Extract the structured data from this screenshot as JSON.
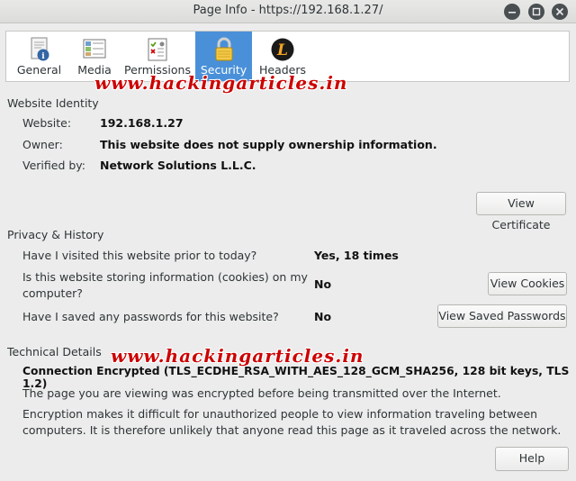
{
  "window": {
    "title": "Page Info - https://192.168.1.27/"
  },
  "tabs": [
    {
      "label": "General",
      "icon": "document-icon"
    },
    {
      "label": "Media",
      "icon": "media-icon"
    },
    {
      "label": "Permissions",
      "icon": "permissions-icon"
    },
    {
      "label": "Security",
      "icon": "lock-icon"
    },
    {
      "label": "Headers",
      "icon": "headers-icon"
    }
  ],
  "watermark": "www.hackingarticles.in",
  "identity": {
    "title": "Website Identity",
    "website_label": "Website:",
    "website_value": "192.168.1.27",
    "owner_label": "Owner:",
    "owner_value": "This website does not supply ownership information.",
    "verified_label": "Verified by:",
    "verified_value": "Network Solutions L.L.C.",
    "view_certificate": "View Certificate"
  },
  "privacy": {
    "title": "Privacy & History",
    "q1": "Have I visited this website prior to today?",
    "a1": "Yes, 18 times",
    "q2_line1": "Is this website storing information (cookies) on my",
    "q2_line2": "computer?",
    "a2": "No",
    "view_cookies": "View Cookies",
    "q3": "Have I saved any passwords for this website?",
    "a3": "No",
    "view_passwords": "View Saved Passwords"
  },
  "technical": {
    "title": "Technical Details",
    "connection": "Connection Encrypted (TLS_ECDHE_RSA_WITH_AES_128_GCM_SHA256, 128 bit keys, TLS 1.2)",
    "line1": "The page you are viewing was encrypted before being transmitted over the Internet.",
    "line2": "Encryption makes it difficult for unauthorized people to view information traveling between",
    "line3": "computers. It is therefore unlikely that anyone read this page as it traveled across the network."
  },
  "help": "Help",
  "colors": {
    "active_tab": "#4a90d9",
    "watermark": "#cc0000"
  }
}
